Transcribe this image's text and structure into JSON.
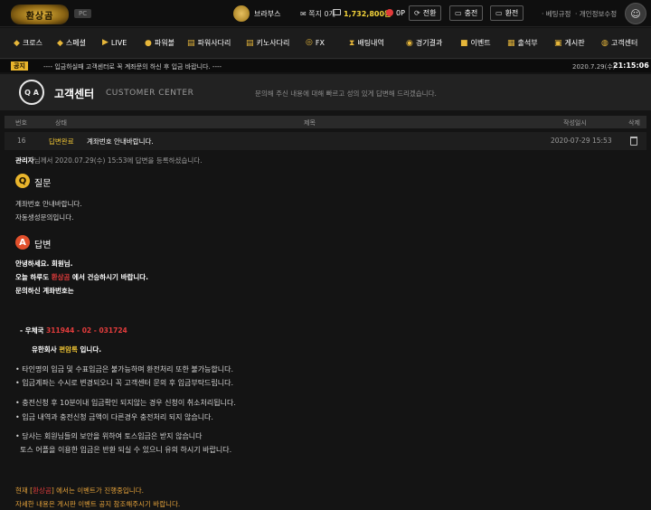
{
  "topbar": {
    "logo": "환상곰",
    "pc_badge": "PC",
    "user": "브라부스",
    "messages": "쪽지 0개",
    "money": "1,732,800원",
    "point": "0P",
    "btn_convert": "전환",
    "btn_charge": "충전",
    "btn_withdraw": "환전",
    "link_rules": "베팅규정",
    "link_profile": "개인정보수정"
  },
  "nav": [
    "크로스",
    "스페셜",
    "LIVE",
    "파워볼",
    "파워사다리",
    "키노사다리",
    "FX",
    "배팅내역",
    "경기결과",
    "이벤트",
    "출석부",
    "게시판",
    "고객센터"
  ],
  "notice": {
    "badge": "공지",
    "text": "---- 입금하실때 고객센터로 꼭 계좌문의 하신 후 입금 바랍니다. ----",
    "date": "2020.7.29(수)",
    "time": "21:15:06"
  },
  "section": {
    "title": "고객센터",
    "subtitle": "CUSTOMER CENTER",
    "desc": "문의해 주신 내용에 대해 빠르고 성의 있게 답변해 드리겠습니다."
  },
  "table": {
    "headers": {
      "no": "번호",
      "status": "상태",
      "subject": "제목",
      "date": "작성일시",
      "delete": "삭제"
    },
    "row": {
      "no": "16",
      "status": "답변완료",
      "subject": "계좌번호 안내바랍니다.",
      "date": "2020-07-29 15:53"
    }
  },
  "detail": {
    "admin": "관리자",
    "byline": "님께서 2020.07.29(수) 15:53에 답변을 등록하셨습니다.",
    "q_badge": "Q",
    "q_title": "질문",
    "q_lines": [
      "계좌번호 안내바랍니다.",
      "자동생성문의입니다."
    ],
    "a_badge": "A",
    "a_title": "답변",
    "greet": "안녕하세요.  회원님.",
    "today_pre": "오늘 하루도 ",
    "brand": "환상곰",
    "today_post": " 에서 건승하시기 바랍니다.",
    "ask": "문의하신 계좌번호는",
    "bank_pre": "- 우체국 ",
    "account": "311944 - 02 - 031724",
    "company_pre": "유한회사 ",
    "company": "편암록",
    "company_post": " 입니다.",
    "bullets": [
      "• 타인명의 입금 및 수표입금은 불가능하며 환전처리 또한 불가능합니다.",
      "• 입금계좌는 수시로 변경되오니 꼭 고객센터 문의 후 입금부탁드립니다.",
      "• 충전신청 후 10분이내 입금확인 되지않는 경우 신청이 취소처리됩니다.",
      "• 입금 내역과 충전신청 금액이 다른경우 충전처리 되지 않습니다.",
      "• 당사는 회원님들의 보안을 위하여 토스입금은 받지 않습니다",
      "  토스 어플을 이용한 입금은 반환 되실 수 있으니 유의 하시기 바랍니다."
    ],
    "event1_pre": "현재 [",
    "event1_brand": "환상곰",
    "event1_post": "] 에서는 이벤트가 진행중입니다.",
    "event2": "자세한 내용은 게시판 이벤트 공지 참조해주시기 바랍니다."
  },
  "colors": {
    "accent": "#e9b52c",
    "money": "#f2d23a",
    "answer_badge": "#e2502c",
    "red_text": "#e23c3c"
  }
}
